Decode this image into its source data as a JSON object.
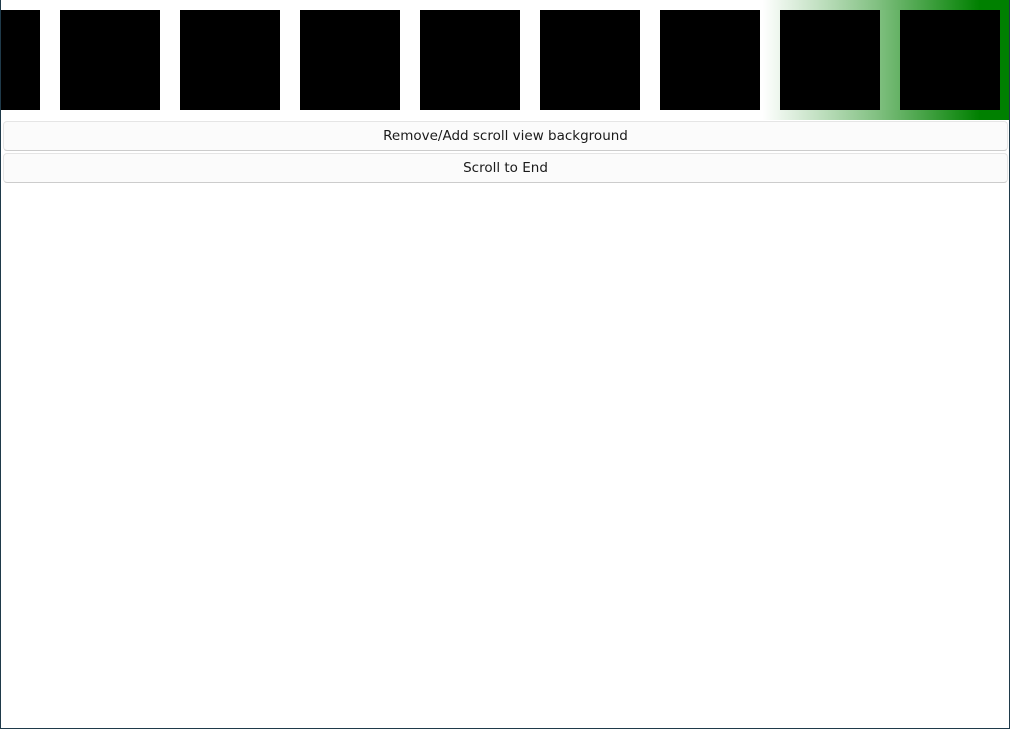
{
  "scroll_view": {
    "background_color": "#008000",
    "tile_color": "#000000",
    "tile_count_visible": 9
  },
  "buttons": {
    "toggle_background_label": "Remove/Add scroll view background",
    "scroll_to_end_label": "Scroll to End"
  }
}
